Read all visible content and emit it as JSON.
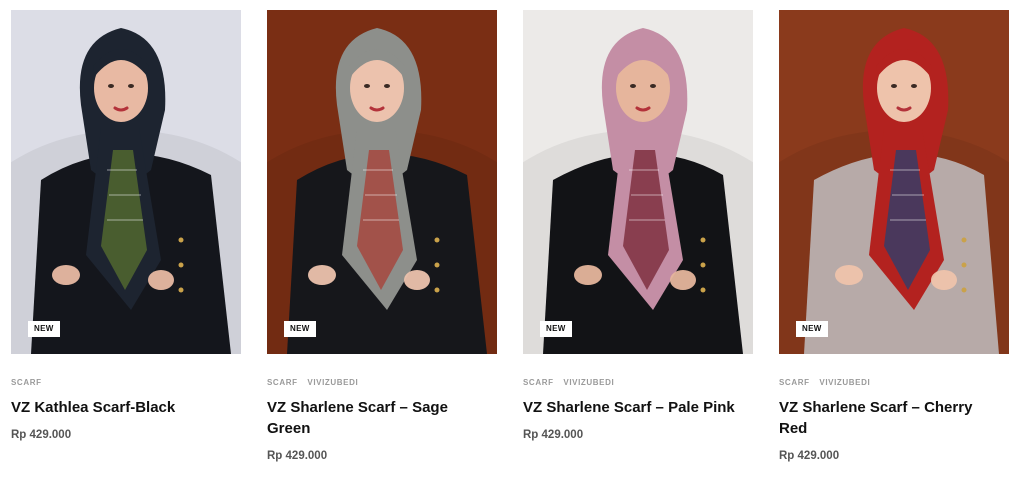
{
  "products": [
    {
      "badge": "NEW",
      "categories": [
        "SCARF"
      ],
      "title": "VZ Kathlea Scarf-Black",
      "price": "Rp 429.000",
      "colors": {
        "background": "#dcdde6",
        "scarf": "#1d2430",
        "accent": "#556b2f",
        "jacket": "#14161c",
        "skin": "#e8b9a3"
      }
    },
    {
      "badge": "NEW",
      "categories": [
        "SCARF",
        "VIVIZUBEDI"
      ],
      "title": "VZ Sharlene Scarf – Sage Green",
      "price": "Rp 429.000",
      "colors": {
        "background": "#7a2e14",
        "scarf": "#8d8f8b",
        "accent": "#a8423a",
        "jacket": "#16171b",
        "skin": "#ecc2ad"
      }
    },
    {
      "badge": "NEW",
      "categories": [
        "SCARF",
        "VIVIZUBEDI"
      ],
      "title": "VZ Sharlene Scarf – Pale Pink",
      "price": "Rp 429.000",
      "colors": {
        "background": "#eceae8",
        "scarf": "#c48ea5",
        "accent": "#7a2a3a",
        "jacket": "#121316",
        "skin": "#e6b59c"
      }
    },
    {
      "badge": "NEW",
      "categories": [
        "SCARF",
        "VIVIZUBEDI"
      ],
      "title": "VZ Sharlene Scarf – Cherry Red",
      "price": "Rp 429.000",
      "colors": {
        "background": "#8a3a1c",
        "scarf": "#b3221f",
        "accent": "#2f3e6b",
        "jacket": "#b7aaa8",
        "skin": "#eec3ab"
      }
    }
  ]
}
